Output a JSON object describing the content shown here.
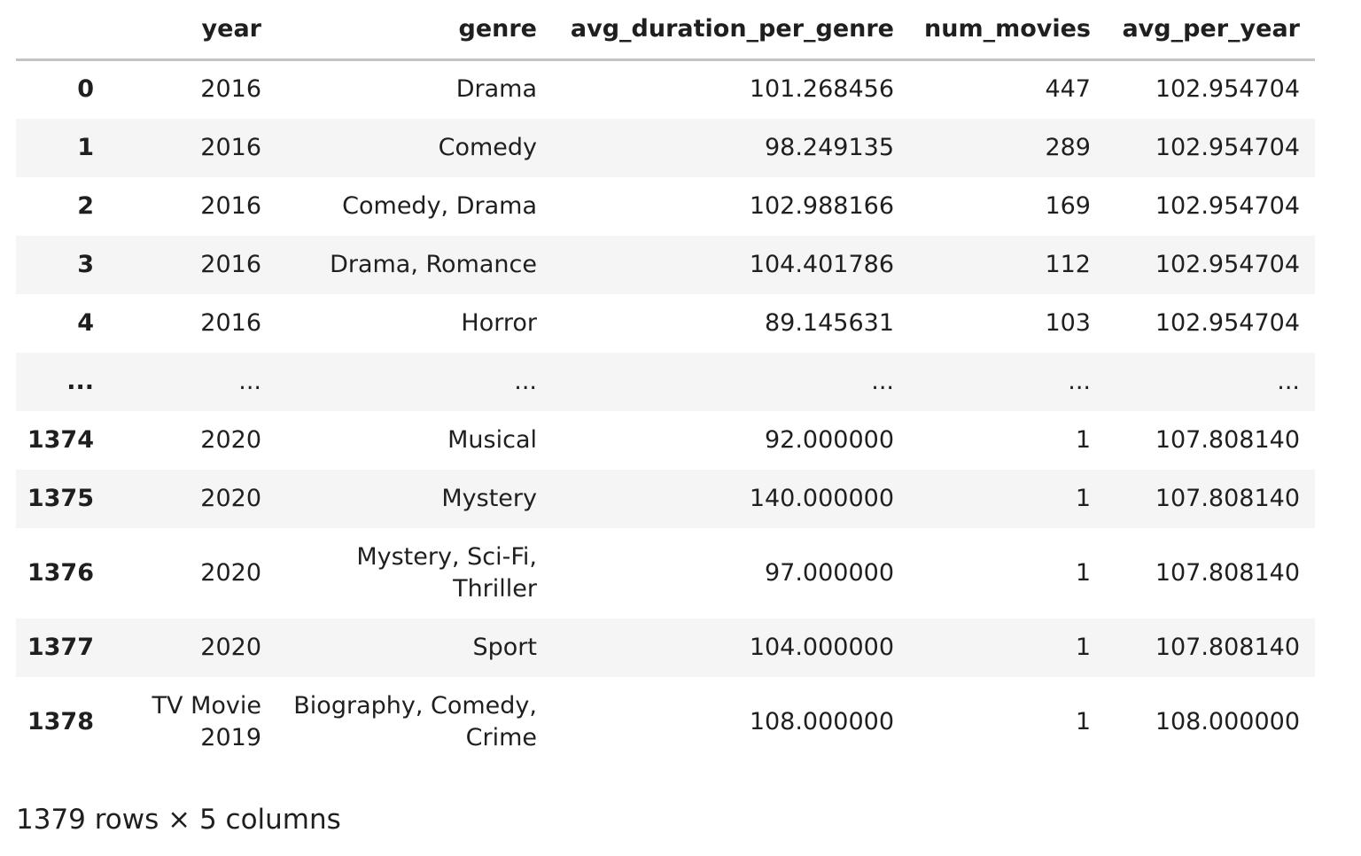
{
  "table": {
    "columns": [
      "",
      "year",
      "genre",
      "avg_duration_per_genre",
      "num_movies",
      "avg_per_year"
    ],
    "rows": [
      {
        "index": "0",
        "year": "2016",
        "genre": "Drama",
        "avg_duration_per_genre": "101.268456",
        "num_movies": "447",
        "avg_per_year": "102.954704"
      },
      {
        "index": "1",
        "year": "2016",
        "genre": "Comedy",
        "avg_duration_per_genre": "98.249135",
        "num_movies": "289",
        "avg_per_year": "102.954704"
      },
      {
        "index": "2",
        "year": "2016",
        "genre": "Comedy, Drama",
        "avg_duration_per_genre": "102.988166",
        "num_movies": "169",
        "avg_per_year": "102.954704"
      },
      {
        "index": "3",
        "year": "2016",
        "genre": "Drama, Romance",
        "avg_duration_per_genre": "104.401786",
        "num_movies": "112",
        "avg_per_year": "102.954704"
      },
      {
        "index": "4",
        "year": "2016",
        "genre": "Horror",
        "avg_duration_per_genre": "89.145631",
        "num_movies": "103",
        "avg_per_year": "102.954704"
      },
      {
        "index": "...",
        "year": "...",
        "genre": "...",
        "avg_duration_per_genre": "...",
        "num_movies": "...",
        "avg_per_year": "..."
      },
      {
        "index": "1374",
        "year": "2020",
        "genre": "Musical",
        "avg_duration_per_genre": "92.000000",
        "num_movies": "1",
        "avg_per_year": "107.808140"
      },
      {
        "index": "1375",
        "year": "2020",
        "genre": "Mystery",
        "avg_duration_per_genre": "140.000000",
        "num_movies": "1",
        "avg_per_year": "107.808140"
      },
      {
        "index": "1376",
        "year": "2020",
        "genre": "Mystery, Sci-Fi, Thriller",
        "avg_duration_per_genre": "97.000000",
        "num_movies": "1",
        "avg_per_year": "107.808140"
      },
      {
        "index": "1377",
        "year": "2020",
        "genre": "Sport",
        "avg_duration_per_genre": "104.000000",
        "num_movies": "1",
        "avg_per_year": "107.808140"
      },
      {
        "index": "1378",
        "year": "TV Movie 2019",
        "genre": "Biography, Comedy, Crime",
        "avg_duration_per_genre": "108.000000",
        "num_movies": "1",
        "avg_per_year": "108.000000"
      }
    ]
  },
  "caption": "1379 rows × 5 columns"
}
